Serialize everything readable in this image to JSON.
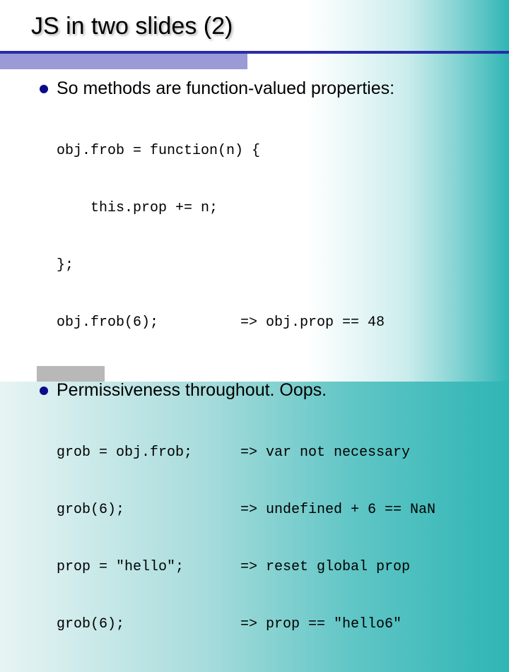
{
  "title": "JS in two slides (2)",
  "bullets": [
    {
      "text": "So methods are function-valued properties:",
      "code": [
        {
          "left": "obj.frob = function(n) {",
          "right": ""
        },
        {
          "left": "    this.prop += n;",
          "right": ""
        },
        {
          "left": "};",
          "right": ""
        },
        {
          "left": "obj.frob(6);",
          "right": "=> obj.prop == 48"
        }
      ]
    },
    {
      "text": "Permissiveness throughout.  Oops.",
      "code": [
        {
          "left": "grob = obj.frob;",
          "right": "=> var not necessary"
        },
        {
          "left": "grob(6);",
          "right": "=> undefined + 6 == NaN"
        },
        {
          "left": "prop = \"hello\";",
          "right": "=> reset global prop"
        },
        {
          "left": "grob(6);",
          "right": "=> prop == \"hello6\""
        }
      ]
    }
  ]
}
